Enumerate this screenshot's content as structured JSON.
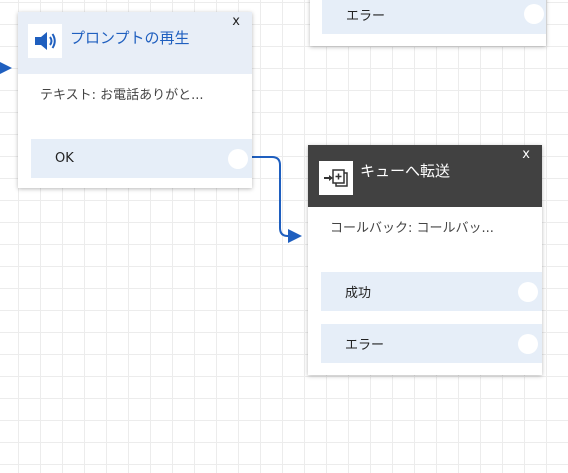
{
  "block_top_right": {
    "branches": {
      "error_label": "エラー"
    }
  },
  "block_play_prompt": {
    "title": "プロンプトの再生",
    "close": "x",
    "parameter": "テキスト: お電話ありがと...",
    "branches": {
      "ok_label": "OK"
    },
    "icon": "speaker-icon"
  },
  "block_transfer_queue": {
    "title": "キューへ転送",
    "close": "x",
    "parameter": "コールバック: コールバッ...",
    "branches": {
      "success_label": "成功",
      "error_label": "エラー"
    },
    "icon": "transfer-to-queue-icon"
  },
  "colors": {
    "accent_blue": "#1f5fbf",
    "header_light": "#e8eef7",
    "header_dark": "#414141",
    "branch_bg": "#e6eef8"
  }
}
